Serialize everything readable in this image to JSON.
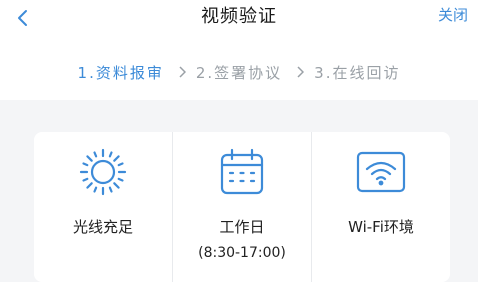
{
  "header": {
    "title": "视频验证",
    "close_label": "关闭"
  },
  "steps": [
    {
      "label": "1.资料报审",
      "active": true
    },
    {
      "label": "2.签署协议",
      "active": false
    },
    {
      "label": "3.在线回访",
      "active": false
    }
  ],
  "requirements": [
    {
      "icon": "sun-icon",
      "label": "光线充足",
      "sub": ""
    },
    {
      "icon": "calendar-icon",
      "label": "工作日",
      "sub": "(8:30-17:00)"
    },
    {
      "icon": "wifi-icon",
      "label": "Wi-Fi环境",
      "sub": ""
    }
  ],
  "colors": {
    "accent": "#3d8bd8",
    "background": "#f4f5f7"
  }
}
